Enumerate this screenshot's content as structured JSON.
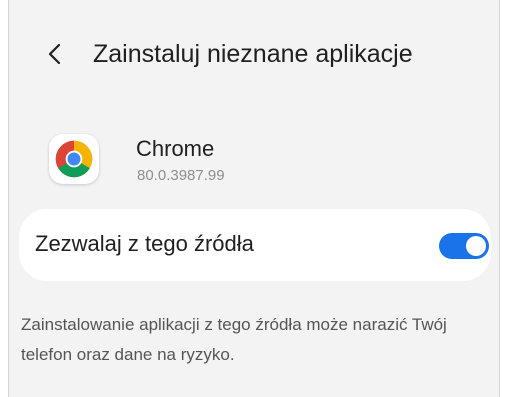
{
  "header": {
    "title": "Zainstaluj nieznane aplikacje",
    "back_icon": "chevron-left-icon"
  },
  "app": {
    "name": "Chrome",
    "version": "80.0.3987.99",
    "icon": "chrome-icon"
  },
  "permission": {
    "label": "Zezwalaj z tego źródła",
    "enabled": true,
    "toggle_color": "#1a73e8"
  },
  "warning": {
    "text": "Zainstalowanie aplikacji z tego źródła może narazić Twój telefon oraz dane na ryzyko."
  }
}
